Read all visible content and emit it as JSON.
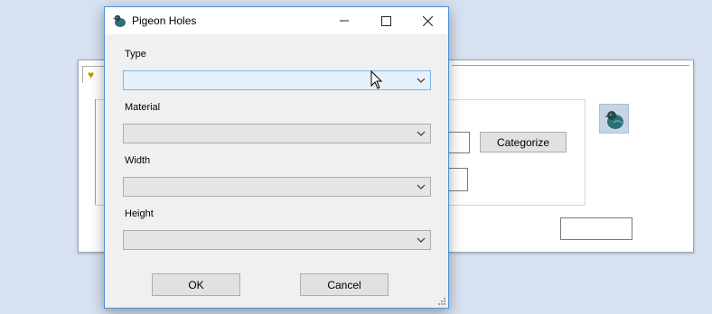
{
  "dialog": {
    "title": "Pigeon Holes",
    "icon": "pigeon-icon",
    "fields": [
      {
        "label": "Type",
        "value": ""
      },
      {
        "label": "Material",
        "value": ""
      },
      {
        "label": "Width",
        "value": ""
      },
      {
        "label": "Height",
        "value": ""
      }
    ],
    "ok_label": "OK",
    "cancel_label": "Cancel"
  },
  "background_window": {
    "categorize_label": "Categorize",
    "icon": "pigeon-icon"
  },
  "colors": {
    "desktop": "#d7e1ef",
    "dialog_border": "#4a90d9",
    "active_combo": "#e5f1fb"
  }
}
